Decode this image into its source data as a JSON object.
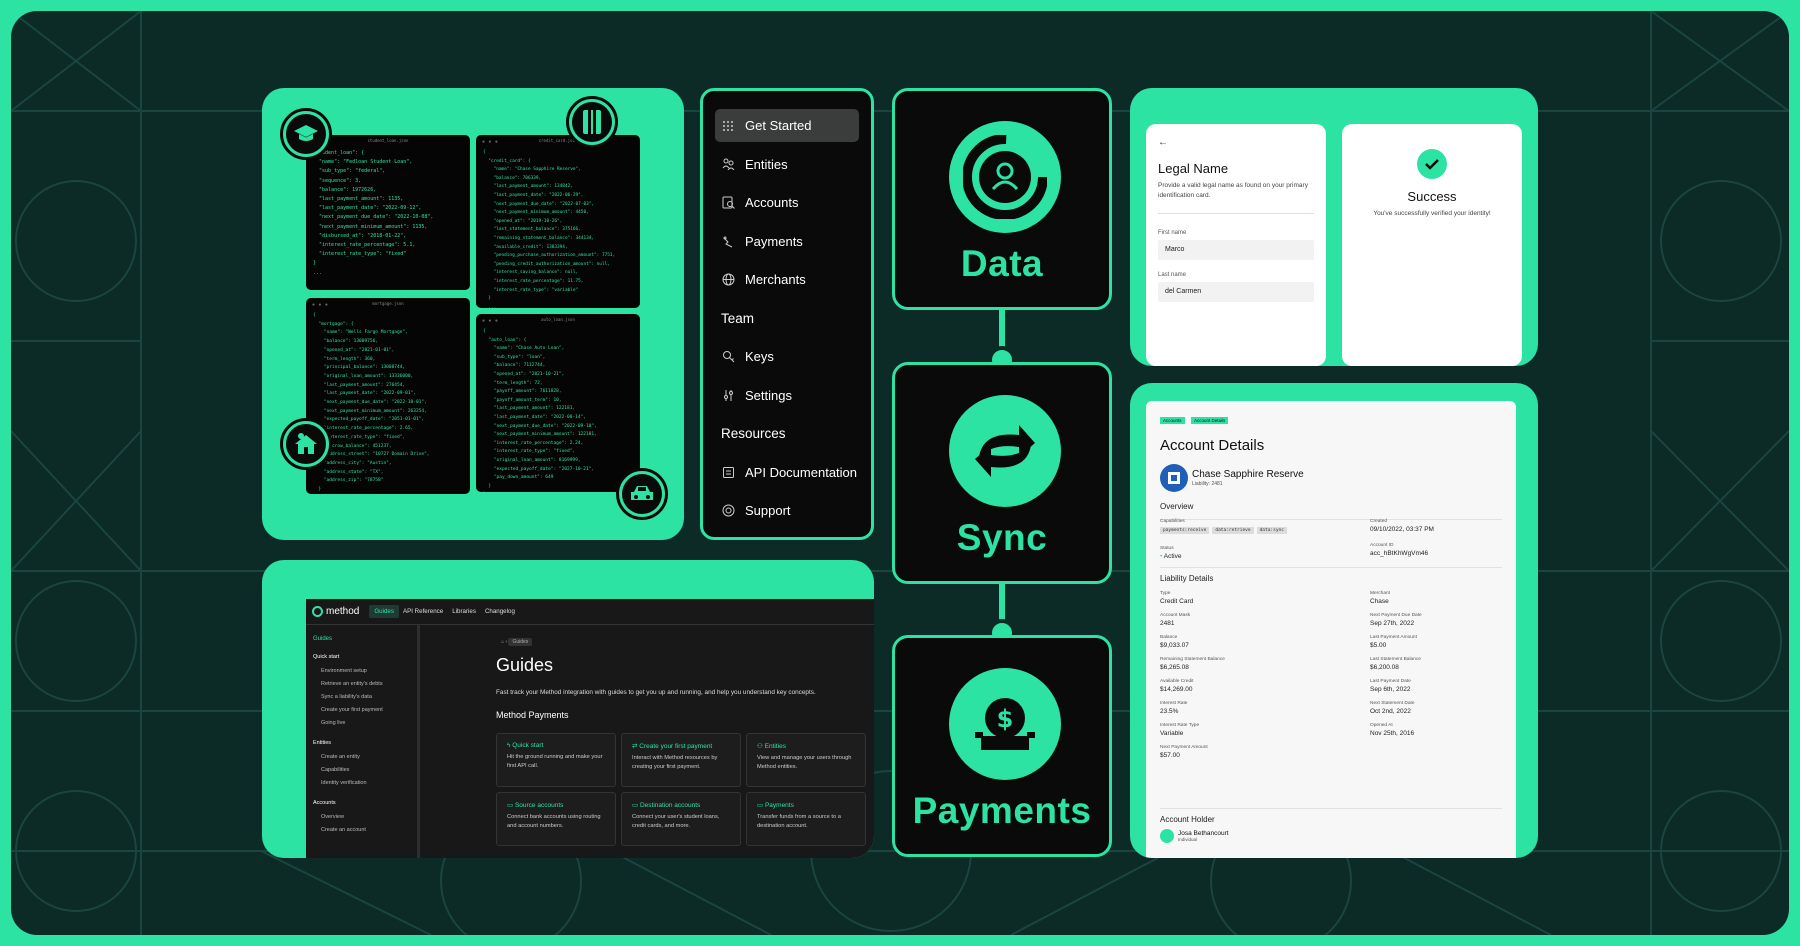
{
  "colors": {
    "accent": "#2de3a4",
    "background": "#0c2a26",
    "black": "#0a0a0a"
  },
  "code_windows": [
    {
      "filename": "student_loan.json",
      "text": "\"student_loan\": {\n  \"name\": \"Fedloan Student Loan\",\n  \"sub_type\": \"federal\",\n  \"sequence\": 3,\n  \"balance\": 1972626,\n  \"last_payment_amount\": 1135,\n  \"last_payment_date\": \"2022-09-12\",\n  \"next_payment_due_date\": \"2022-10-08\",\n  \"next_payment_minimum_amount\": 1135,\n  \"disbursed_at\": \"2018-01-22\",\n  \"interest_rate_percentage\": 5.1,\n  \"interest_rate_type\": \"fixed\"\n}\n..."
    },
    {
      "filename": "credit_card.json",
      "text": "{\n  \"credit_card\": {\n    \"name\": \"Chase Sapphire Reserve\",\n    \"balance\": 706339,\n    \"last_payment_amount\": 134842,\n    \"last_payment_date\": \"2022-06-29\",\n    \"next_payment_due_date\": \"2022-07-03\",\n    \"next_payment_minimum_amount\": 4450,\n    \"opened_at\": \"2019-10-26\",\n    \"last_statement_balance\": 375166,\n    \"remaining_statement_balance\": 344134,\n    \"available_credit\": 1383394,\n    \"pending_purchase_authorization_amount\": 7751,\n    \"pending_credit_authorization_amount\": null,\n    \"interest_saving_balance\": null,\n    \"interest_rate_percentage\": 11.75,\n    \"interest_rate_type\": \"variable\"\n  }\n  ...\n}"
    },
    {
      "filename": "mortgage.json",
      "text": "{\n  \"mortgage\": {\n    \"name\": \"Wells Fargo Mortgage\",\n    \"balance\": 13009756,\n    \"opened_at\": \"2021-01-01\",\n    \"term_length\": 360,\n    \"principal_balance\": 13008744,\n    \"original_loan_amount\": 13336000,\n    \"last_payment_amount\": 276454,\n    \"last_payment_date\": \"2022-09-01\",\n    \"next_payment_due_date\": \"2022-10-01\",\n    \"next_payment_minimum_amount\": 263254,\n    \"expected_payoff_date\": \"2051-01-01\",\n    \"interest_rate_percentage\": 2.65,\n    \"interest_rate_type\": \"fixed\",\n    \"escrow_balance\": 451237,\n    \"address_street\": \"10727 Domain Drive\",\n    \"address_city\": \"Austin\",\n    \"address_state\": \"TX\",\n    \"address_zip\": \"78758\"\n  }\n}"
    },
    {
      "filename": "auto_loan.json",
      "text": "{\n  \"auto_loan\": {\n    \"name\": \"Chase Auto Loan\",\n    \"sub_type\": \"loan\",\n    \"balance\": 7112744,\n    \"opened_at\": \"2021-10-21\",\n    \"term_length\": 72,\n    \"payoff_amount\": 7611828,\n    \"payoff_amount_term\": 10,\n    \"last_payment_amount\": 122181,\n    \"last_payment_date\": \"2022-08-14\",\n    \"next_payment_due_date\": \"2022-09-10\",\n    \"next_payment_minimum_amount\": 122181,\n    \"interest_rate_percentage\": 2.24,\n    \"interest_rate_type\": \"fixed\",\n    \"original_loan_amount\": 8169999,\n    \"expected_payoff_date\": \"2027-10-21\",\n    \"pay_down_amount\": 649\n  }\n}"
    }
  ],
  "nav": {
    "items": [
      {
        "label": "Get Started",
        "icon": "grid-icon",
        "active": true
      },
      {
        "label": "Entities",
        "icon": "people-icon"
      },
      {
        "label": "Accounts",
        "icon": "document-search-icon"
      },
      {
        "label": "Payments",
        "icon": "transfer-icon"
      },
      {
        "label": "Merchants",
        "icon": "globe-icon"
      },
      {
        "label": "Team",
        "section": true
      },
      {
        "label": "Keys",
        "icon": "key-icon"
      },
      {
        "label": "Settings",
        "icon": "sliders-icon"
      },
      {
        "label": "Resources",
        "section": true
      },
      {
        "label": "API Documentation",
        "icon": "book-icon"
      },
      {
        "label": "Support",
        "icon": "lifebuoy-icon"
      }
    ]
  },
  "stages": {
    "data": "Data",
    "sync": "Sync",
    "payments": "Payments"
  },
  "legal_form": {
    "back": "←",
    "title": "Legal Name",
    "subtitle": "Provide a valid legal name as found on your primary identification card.",
    "first_label": "First name",
    "first_value": "Marco",
    "last_label": "Last name",
    "last_value": "del Carmen"
  },
  "success": {
    "title": "Success",
    "message": "You've successfully verified your identity!"
  },
  "docs": {
    "logo": "method",
    "tabs": [
      "Guides",
      "API Reference",
      "Libraries",
      "Changelog"
    ],
    "sidebar": {
      "guides": "Guides",
      "quick_start": "Quick start",
      "quick_items": [
        "Environment setup",
        "Retrieve an entity's debts",
        "Sync a liability's data",
        "Create your first payment",
        "Going live"
      ],
      "entities": "Entities",
      "entity_items": [
        "Create an entity",
        "Capabilities",
        "Identity verification"
      ],
      "accounts": "Accounts",
      "account_items": [
        "Overview",
        "Create an account"
      ]
    },
    "breadcrumb": "Guides",
    "title": "Guides",
    "intro": "Fast track your Method integration with guides to get you up and running, and help you understand key concepts.",
    "section": "Method Payments",
    "cards": [
      {
        "title": "Quick start",
        "desc": "Hit the ground running and make your first API call.",
        "icon": "bolt-icon"
      },
      {
        "title": "Create your first payment",
        "desc": "Interact with Method resources by creating your first payment.",
        "icon": "transfer-icon"
      },
      {
        "title": "Entities",
        "desc": "View and manage your users through Method entities.",
        "icon": "people-icon"
      },
      {
        "title": "Source accounts",
        "desc": "Connect bank accounts using routing and account numbers.",
        "icon": "bank-icon"
      },
      {
        "title": "Destination accounts",
        "desc": "Connect your user's student loans, credit cards, and more.",
        "icon": "card-icon"
      },
      {
        "title": "Payments",
        "desc": "Transfer funds from a source to a destination account.",
        "icon": "payment-icon"
      }
    ]
  },
  "account": {
    "crumbs": [
      "Accounts",
      "Account Details"
    ],
    "title": "Account Details",
    "name": "Chase Sapphire Reserve",
    "sub": "Liability: 2481",
    "overview": "Overview",
    "capabilities_label": "Capabilities",
    "capabilities": [
      "payments:receive",
      "data:retrieve",
      "data:sync"
    ],
    "created_label": "Created",
    "created": "09/10/2022, 03:37 PM",
    "status_label": "Status",
    "status": "Active",
    "account_id_label": "Account ID",
    "account_id": "acc_hBtKhWgVm46",
    "liability": "Liability Details",
    "left": [
      {
        "k": "Type",
        "v": "Credit Card"
      },
      {
        "k": "Account Mask",
        "v": "2481"
      },
      {
        "k": "Balance",
        "v": "$9,033.07"
      },
      {
        "k": "Remaining Statement Balance",
        "v": "$6,265.08"
      },
      {
        "k": "Available Credit",
        "v": "$14,269.00"
      },
      {
        "k": "Interest Rate",
        "v": "23.5%"
      },
      {
        "k": "Interest Rate Type",
        "v": "Variable"
      },
      {
        "k": "Next Payment Amount",
        "v": "$57.00"
      }
    ],
    "right": [
      {
        "k": "Merchant",
        "v": "Chase"
      },
      {
        "k": "Next Payment Due Date",
        "v": "Sep 27th, 2022"
      },
      {
        "k": "Last Payment Amount",
        "v": "$5.00"
      },
      {
        "k": "Last Statement Balance",
        "v": "$6,200.08"
      },
      {
        "k": "Last Payment Date",
        "v": "Sep 6th, 2022"
      },
      {
        "k": "Next Statement Date",
        "v": "Oct 2nd, 2022"
      },
      {
        "k": "Opened At",
        "v": "Nov 25th, 2016"
      }
    ],
    "holder_title": "Account Holder",
    "holder": "Josa Bethancourt",
    "holder_type": "Individual"
  }
}
